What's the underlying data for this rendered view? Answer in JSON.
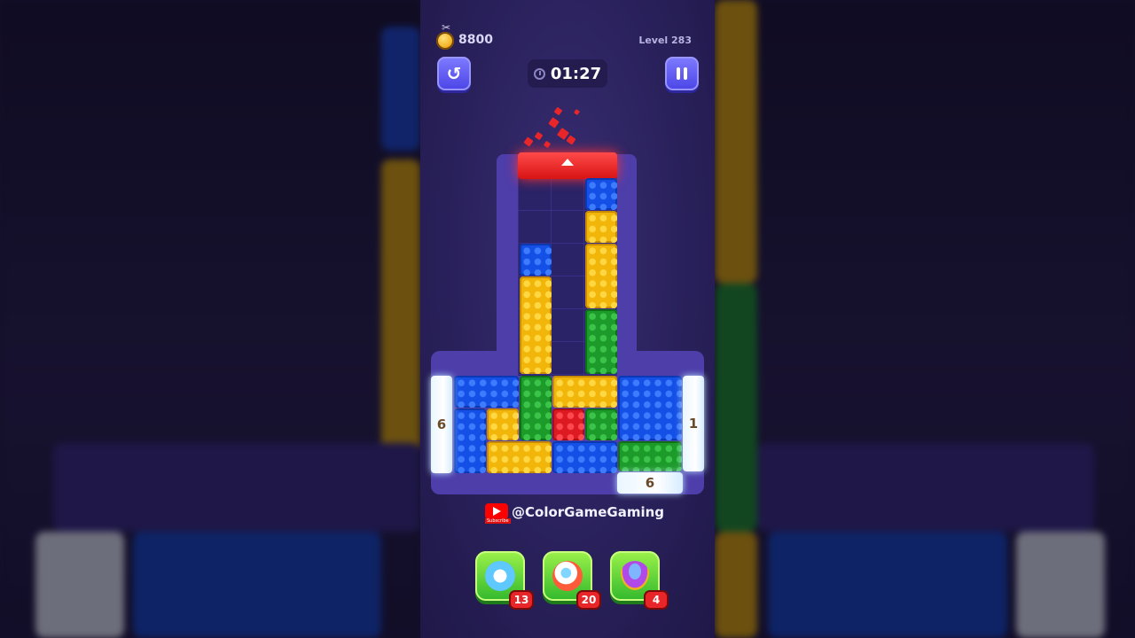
{
  "hud": {
    "coins": "8800",
    "level": "Level 283",
    "timer": "01:27"
  },
  "channel": {
    "handle": "@ColorGameGaming",
    "subscribe": "Subscribe"
  },
  "counters": {
    "left": "6",
    "right": "1",
    "bottom": "6"
  },
  "boosters": [
    {
      "name": "alarm-clock-booster",
      "count": "13",
      "icon_color": "#5ec8ff"
    },
    {
      "name": "rocket-booster",
      "count": "20",
      "icon_color": "#ff5a3a"
    },
    {
      "name": "ufo-booster",
      "count": "4",
      "icon_color": "#b148e8"
    }
  ],
  "colors": {
    "blue": "#1550e6",
    "yellow": "#f2b60a",
    "green": "#1c9a2a",
    "red": "#dd1a22",
    "board": "#4d3eaa"
  }
}
